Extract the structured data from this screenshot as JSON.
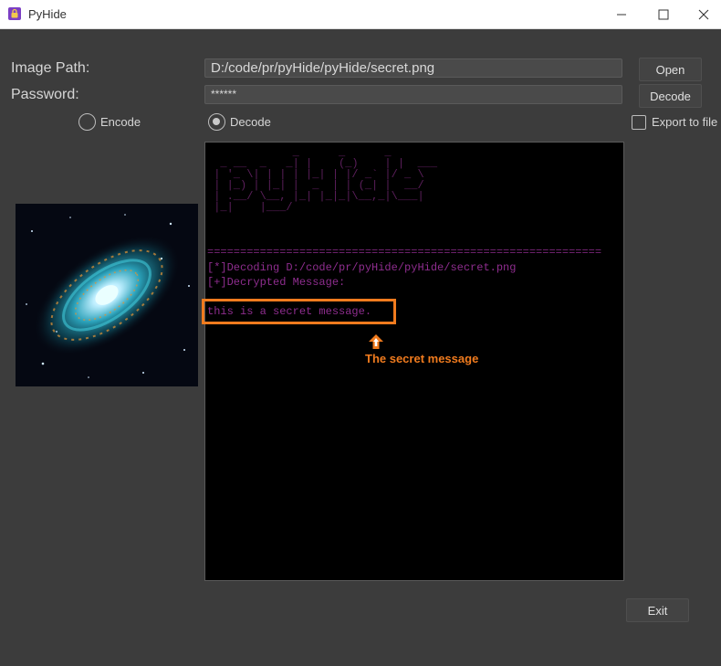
{
  "window": {
    "title": "PyHide"
  },
  "form": {
    "image_path_label": "Image Path:",
    "image_path_value": "D:/code/pr/pyHide/pyHide/secret.png",
    "password_label": "Password:",
    "password_value": "******",
    "open_button": "Open",
    "decode_button": "Decode",
    "mode_encode": "Encode",
    "mode_decode": "Decode",
    "selected_mode": "Decode",
    "export_label": "Export to file",
    "export_checked": false
  },
  "console": {
    "ascii_art": "             _      _      _\n  _ __  _   _| |    (_)    | |  ___\n | '_ \\| | | | |_| | |/ _` |/ _ \\\n | |_) | |_| |  _  | | (_| |  __/\n | .__/ \\__, |_| |_|_|\\__,_|\\___|\n |_|    |___/",
    "separator": "============================================================",
    "line_decoding": "[*]Decoding D:/code/pr/pyHide/pyHide/secret.png",
    "line_decrypted": "[+]Decrypted Message:",
    "message": "this is a secret message."
  },
  "annotation": {
    "label": "The secret message",
    "color": "#f07b1e"
  },
  "footer": {
    "exit_button": "Exit"
  },
  "colors": {
    "window_bg": "#3c3c3c",
    "console_text": "#8e2d8e",
    "accent_orange": "#f07b1e"
  }
}
